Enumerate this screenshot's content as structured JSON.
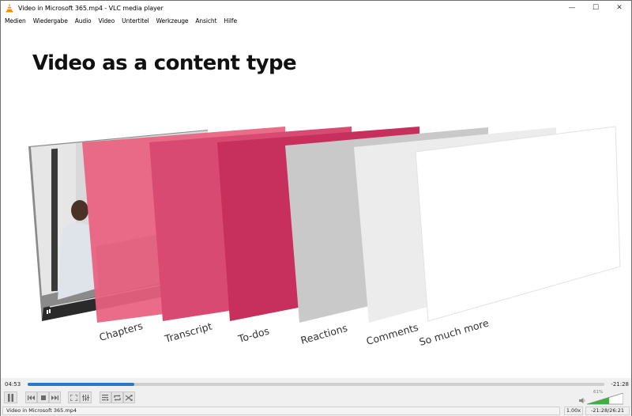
{
  "window": {
    "title": "Video in Microsoft 365.mp4 - VLC media player",
    "controls": {
      "minimize": "—",
      "maximize": "☐",
      "close": "✕"
    }
  },
  "menu": [
    {
      "label": "Medien"
    },
    {
      "label": "Wiedergabe"
    },
    {
      "label": "Audio"
    },
    {
      "label": "Video"
    },
    {
      "label": "Untertitel"
    },
    {
      "label": "Werkzeuge"
    },
    {
      "label": "Ansicht"
    },
    {
      "label": "Hilfe"
    }
  ],
  "slide": {
    "title": "Video as a content type",
    "layers": [
      {
        "label": "Chapters",
        "color": "#e8617f"
      },
      {
        "label": "Transcript",
        "color": "#d84a72"
      },
      {
        "label": "To-dos",
        "color": "#c7305c"
      },
      {
        "label": "Reactions",
        "color": "#c9c9c9"
      },
      {
        "label": "Comments",
        "color": "#ececec"
      },
      {
        "label": "So much more",
        "color": "#ffffff"
      }
    ]
  },
  "playback": {
    "elapsed": "04:53",
    "remaining": "-21:28",
    "progress_percent": 18.5,
    "accent_color": "#2b78c9"
  },
  "volume": {
    "percent_label": "61%",
    "level": 0.61,
    "color": "#3cb043"
  },
  "status": {
    "filename": "Video in Microsoft 365.mp4",
    "speed": "1.00x",
    "time": "-21:28/26:21"
  }
}
